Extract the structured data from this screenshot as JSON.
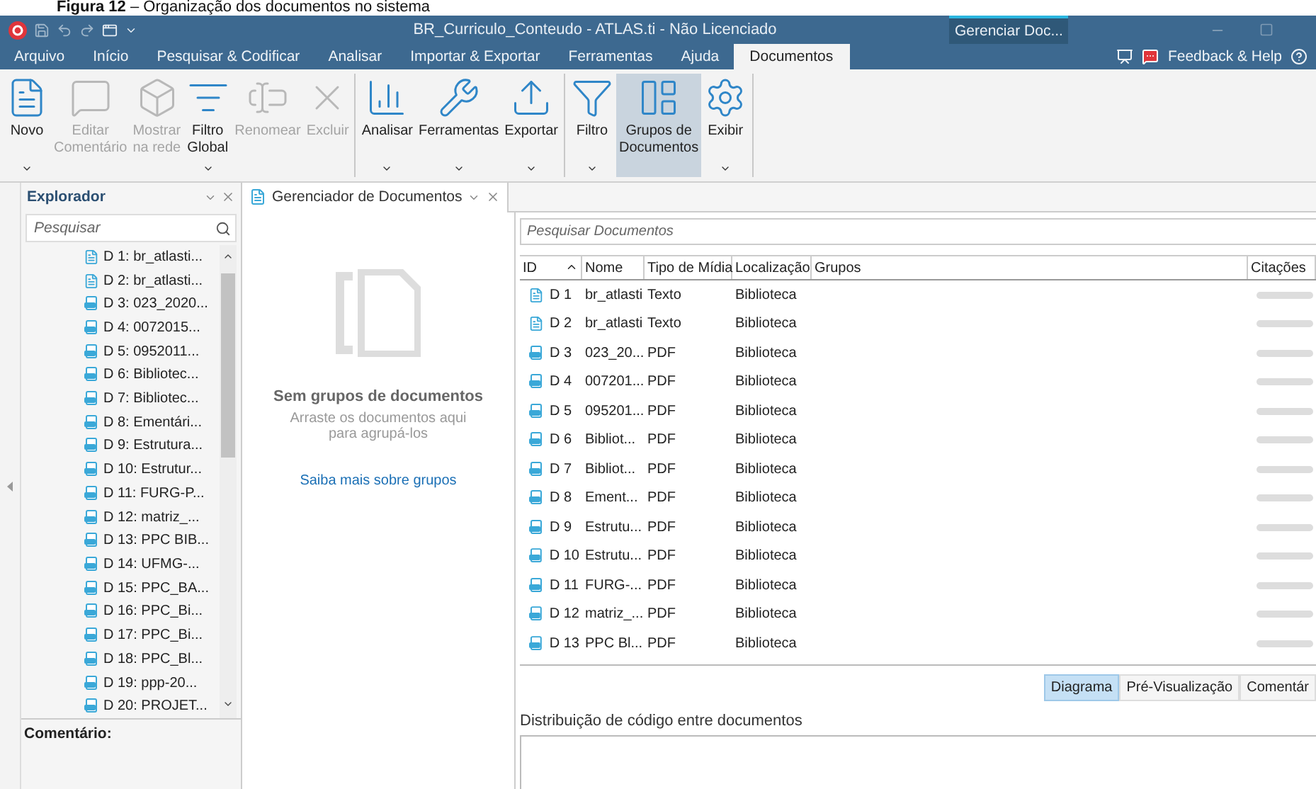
{
  "caption": "**Figura 12** – Organização dos documentos no sistema",
  "window": {
    "title": "BR_Curriculo_Conteudo - ATLAS.ti - Não Licenciado",
    "context_tab": "Gerenciar Doc..."
  },
  "menu_tabs": [
    {
      "label": "Arquivo",
      "selected": false
    },
    {
      "label": "Início",
      "selected": false
    },
    {
      "label": "Pesquisar & Codificar",
      "selected": false
    },
    {
      "label": "Analisar",
      "selected": false
    },
    {
      "label": "Importar & Exportar",
      "selected": false
    },
    {
      "label": "Ferramentas",
      "selected": false
    },
    {
      "label": "Ajuda",
      "selected": false
    },
    {
      "label": "Documentos",
      "selected": true
    }
  ],
  "feedback": "Feedback & Help",
  "ribbon_groups": [
    [
      {
        "label": "Novo",
        "disabled": false,
        "dropdown": true,
        "selected": false
      },
      {
        "label": "Editar\nComentário",
        "disabled": true,
        "dropdown": false,
        "selected": false
      },
      {
        "label": "Mostrar\nna rede",
        "disabled": true,
        "dropdown": false,
        "selected": false
      },
      {
        "label": "Filtro\nGlobal",
        "disabled": false,
        "dropdown": true,
        "selected": false
      },
      {
        "label": "Renomear",
        "disabled": true,
        "dropdown": false,
        "selected": false
      },
      {
        "label": "Excluir",
        "disabled": true,
        "dropdown": false,
        "selected": false
      }
    ],
    [
      {
        "label": "Analisar",
        "disabled": false,
        "dropdown": true,
        "selected": false
      },
      {
        "label": "Ferramentas",
        "disabled": false,
        "dropdown": true,
        "selected": false
      },
      {
        "label": "Exportar",
        "disabled": false,
        "dropdown": true,
        "selected": false
      }
    ],
    [
      {
        "label": "Filtro",
        "disabled": false,
        "dropdown": true,
        "selected": false
      },
      {
        "label": "Grupos de\nDocumentos",
        "disabled": false,
        "dropdown": false,
        "selected": true
      },
      {
        "label": "Exibir",
        "disabled": false,
        "dropdown": true,
        "selected": false
      }
    ]
  ],
  "explorer": {
    "title": "Explorador",
    "search": {
      "placeholder": "Pesquisar"
    },
    "items": [
      {
        "label": "D 1: br_atlasti...",
        "kind": "text"
      },
      {
        "label": "D 2: br_atlasti...",
        "kind": "text"
      },
      {
        "label": "D 3: 023_2020...",
        "kind": "pdf"
      },
      {
        "label": "D 4: 0072015...",
        "kind": "pdf"
      },
      {
        "label": "D 5: 0952011...",
        "kind": "pdf"
      },
      {
        "label": "D 6: Bibliotec...",
        "kind": "pdf"
      },
      {
        "label": "D 7: Bibliotec...",
        "kind": "pdf"
      },
      {
        "label": "D 8: Ementári...",
        "kind": "pdf"
      },
      {
        "label": "D 9: Estrutura...",
        "kind": "pdf"
      },
      {
        "label": "D 10: Estrutur...",
        "kind": "pdf"
      },
      {
        "label": "D 11: FURG-P...",
        "kind": "pdf"
      },
      {
        "label": "D 12: matriz_...",
        "kind": "pdf"
      },
      {
        "label": "D 13: PPC BIB...",
        "kind": "pdf"
      },
      {
        "label": "D 14: UFMG-...",
        "kind": "pdf"
      },
      {
        "label": "D 15: PPC_BA...",
        "kind": "pdf"
      },
      {
        "label": "D 16: PPC_Bi...",
        "kind": "pdf"
      },
      {
        "label": "D 17: PPC_Bi...",
        "kind": "pdf"
      },
      {
        "label": "D 18: PPC_Bl...",
        "kind": "pdf"
      },
      {
        "label": "D 19: ppp-20...",
        "kind": "pdf"
      },
      {
        "label": "D 20: PROJET...",
        "kind": "pdf"
      }
    ],
    "comment_label": "Comentário:"
  },
  "manager": {
    "tab": "Gerenciador de Documentos",
    "groups_pane": {
      "title": "Sem grupos de documentos",
      "hint": "Arraste os documentos aqui para agrupá-los",
      "link": "Saiba mais sobre grupos"
    },
    "search": {
      "placeholder": "Pesquisar Documentos"
    },
    "columns": [
      "ID",
      "Nome",
      "Tipo de Mídia",
      "Localização",
      "Grupos",
      "Citações"
    ],
    "rows": [
      {
        "id": "D 1",
        "name": "br_atlasti",
        "type": "Texto",
        "location": "Biblioteca",
        "kind": "text"
      },
      {
        "id": "D 2",
        "name": "br_atlasti",
        "type": "Texto",
        "location": "Biblioteca",
        "kind": "text"
      },
      {
        "id": "D 3",
        "name": "023_20...",
        "type": "PDF",
        "location": "Biblioteca",
        "kind": "pdf"
      },
      {
        "id": "D 4",
        "name": "007201...",
        "type": "PDF",
        "location": "Biblioteca",
        "kind": "pdf"
      },
      {
        "id": "D 5",
        "name": "095201...",
        "type": "PDF",
        "location": "Biblioteca",
        "kind": "pdf"
      },
      {
        "id": "D 6",
        "name": "Bibliot...",
        "type": "PDF",
        "location": "Biblioteca",
        "kind": "pdf"
      },
      {
        "id": "D 7",
        "name": "Bibliot...",
        "type": "PDF",
        "location": "Biblioteca",
        "kind": "pdf"
      },
      {
        "id": "D 8",
        "name": "Ement...",
        "type": "PDF",
        "location": "Biblioteca",
        "kind": "pdf"
      },
      {
        "id": "D 9",
        "name": "Estrutu...",
        "type": "PDF",
        "location": "Biblioteca",
        "kind": "pdf"
      },
      {
        "id": "D 10",
        "name": "Estrutu...",
        "type": "PDF",
        "location": "Biblioteca",
        "kind": "pdf"
      },
      {
        "id": "D 11",
        "name": "FURG-...",
        "type": "PDF",
        "location": "Biblioteca",
        "kind": "pdf"
      },
      {
        "id": "D 12",
        "name": "matriz_...",
        "type": "PDF",
        "location": "Biblioteca",
        "kind": "pdf"
      },
      {
        "id": "D 13",
        "name": "PPC Bl...",
        "type": "PDF",
        "location": "Biblioteca",
        "kind": "pdf"
      }
    ],
    "detail_tabs": [
      {
        "label": "Diagrama",
        "selected": true
      },
      {
        "label": "Pré-Visualização",
        "selected": false
      },
      {
        "label": "Comentár",
        "selected": false
      }
    ],
    "detail_title": "Distribuição de código entre documentos"
  }
}
